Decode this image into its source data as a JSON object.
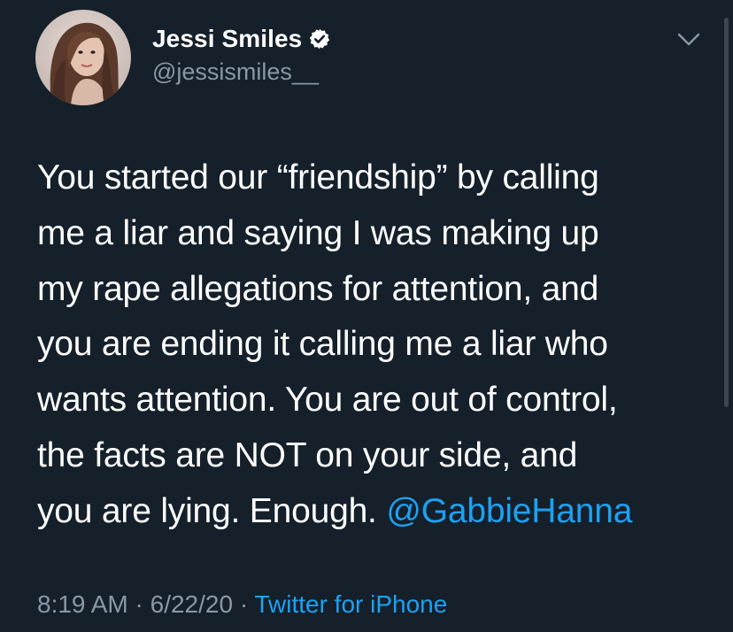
{
  "author": {
    "display_name": "Jessi Smiles",
    "handle": "@jessismiles__",
    "verified": true,
    "avatar_icon": "profile-photo"
  },
  "tweet": {
    "lines": [
      "You started our “friendship” by calling",
      "me a liar and saying I was making up",
      "my rape allegations for attention, and",
      "you are ending it calling me a liar who",
      "wants attention. You are out of control,",
      "the facts are NOT on your side, and",
      "you are lying. Enough. "
    ],
    "mention": "@GabbieHanna"
  },
  "meta": {
    "time": "8:19 AM",
    "separator": " · ",
    "date": "6/22/20",
    "source": "Twitter for iPhone"
  },
  "colors": {
    "background": "#15202b",
    "text": "#ffffff",
    "secondary": "#8899a6",
    "accent": "#1da1f2"
  },
  "icons": {
    "more_menu": "chevron-down-icon",
    "verified": "verified-badge-icon"
  }
}
